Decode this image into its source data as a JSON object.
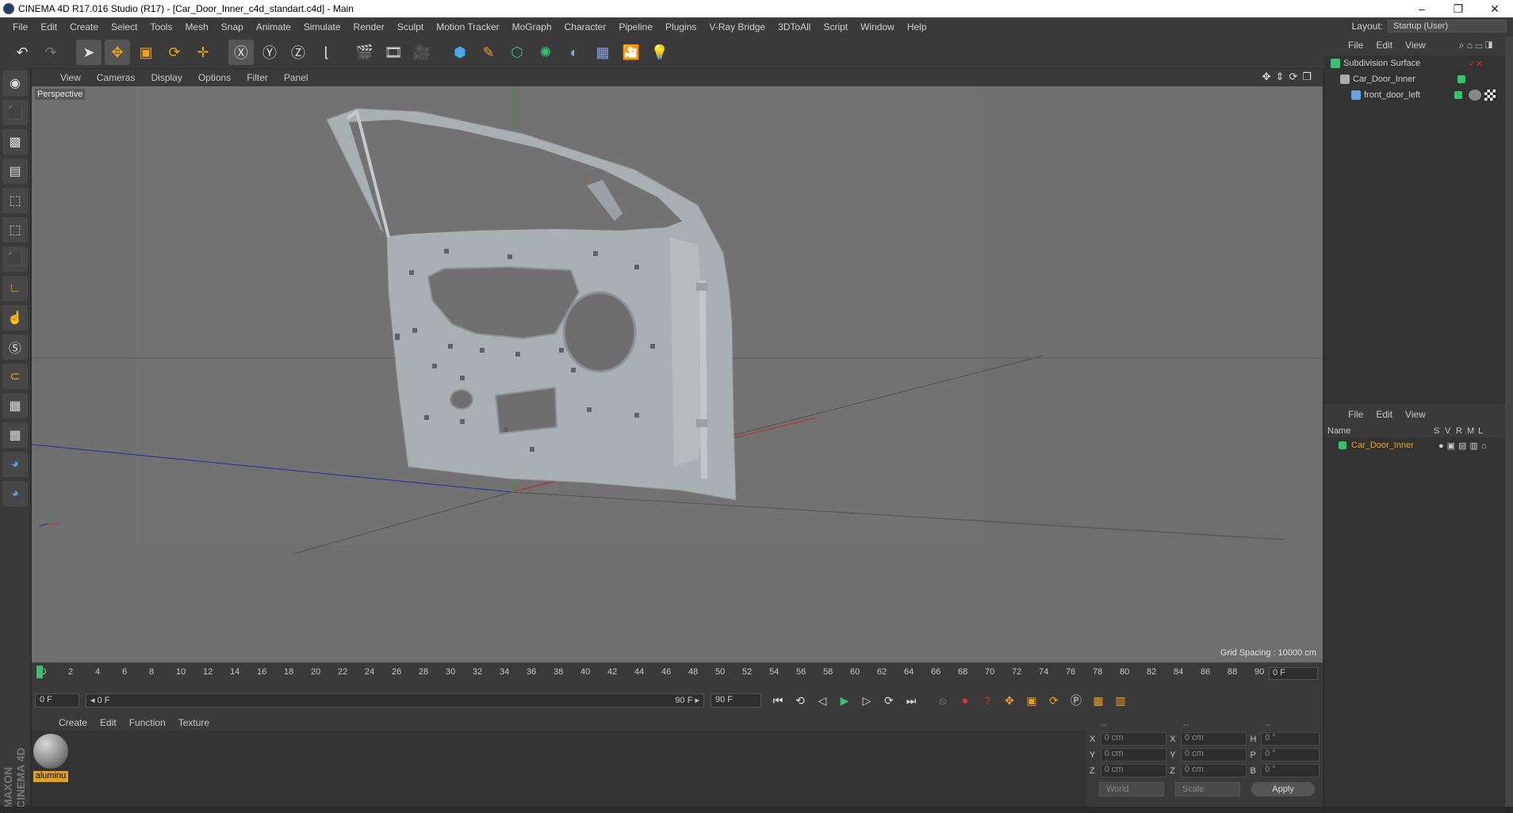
{
  "window": {
    "title": "CINEMA 4D R17.016 Studio (R17) - [Car_Door_Inner_c4d_standart.c4d] - Main",
    "controls": [
      "–",
      "❐",
      "✕"
    ]
  },
  "menubar": {
    "items": [
      "File",
      "Edit",
      "Create",
      "Select",
      "Tools",
      "Mesh",
      "Snap",
      "Animate",
      "Simulate",
      "Render",
      "Sculpt",
      "Motion Tracker",
      "MoGraph",
      "Character",
      "Pipeline",
      "Plugins",
      "V-Ray Bridge",
      "3DToAll",
      "Script",
      "Window",
      "Help"
    ],
    "layout_label": "Layout:",
    "layout_value": "Startup (User)"
  },
  "viewport": {
    "menu": [
      "View",
      "Cameras",
      "Display",
      "Options",
      "Filter",
      "Panel"
    ],
    "camera_label": "Perspective",
    "grid_spacing": "Grid Spacing : 10000 cm",
    "colors": {
      "bg": "#6f6f6f",
      "model": "#a9b0b3",
      "x_axis": "#c03030",
      "y_axis": "#2fa02f",
      "z_axis": "#2a2aa8"
    }
  },
  "timeline": {
    "ticks": [
      "0",
      "2",
      "4",
      "6",
      "8",
      "10",
      "12",
      "14",
      "16",
      "18",
      "20",
      "22",
      "24",
      "26",
      "28",
      "30",
      "32",
      "34",
      "36",
      "38",
      "40",
      "42",
      "44",
      "46",
      "48",
      "50",
      "52",
      "54",
      "56",
      "58",
      "60",
      "62",
      "64",
      "66",
      "68",
      "70",
      "72",
      "74",
      "76",
      "78",
      "80",
      "82",
      "84",
      "86",
      "88",
      "90"
    ],
    "current_frame": "0 F",
    "start_field": "0 F",
    "range_start": "◂ 0 F",
    "range_end": "90 F ▸",
    "end_field": "90 F"
  },
  "material_manager": {
    "menu": [
      "Create",
      "Edit",
      "Function",
      "Texture"
    ],
    "materials": [
      {
        "name": "aluminu"
      }
    ]
  },
  "coordinates": {
    "header_a": "--",
    "header_b": "--",
    "header_c": "--",
    "rows": [
      {
        "pos_axis": "X",
        "pos": "0 cm",
        "size_axis": "X",
        "size": "0 cm",
        "rot_axis": "H",
        "rot": "0 °"
      },
      {
        "pos_axis": "Y",
        "pos": "0 cm",
        "size_axis": "Y",
        "size": "0 cm",
        "rot_axis": "P",
        "rot": "0 °"
      },
      {
        "pos_axis": "Z",
        "pos": "0 cm",
        "size_axis": "Z",
        "size": "0 cm",
        "rot_axis": "B",
        "rot": "0 °"
      }
    ],
    "mode": "World",
    "scale": "Scale",
    "apply": "Apply"
  },
  "object_manager": {
    "menu": [
      "File",
      "Edit",
      "View"
    ],
    "objects": [
      {
        "name": "Subdivision Surface",
        "depth": 0
      },
      {
        "name": "Car_Door_Inner",
        "depth": 1
      },
      {
        "name": "front_door_left",
        "depth": 2
      }
    ]
  },
  "layer_manager": {
    "menu": [
      "File",
      "Edit",
      "View"
    ],
    "columns": [
      "Name",
      "S",
      "V",
      "R",
      "M",
      "L"
    ],
    "layers": [
      {
        "name": "Car_Door_Inner",
        "color": "#34c26a"
      }
    ]
  },
  "branding": "MAXON CINEMA 4D"
}
